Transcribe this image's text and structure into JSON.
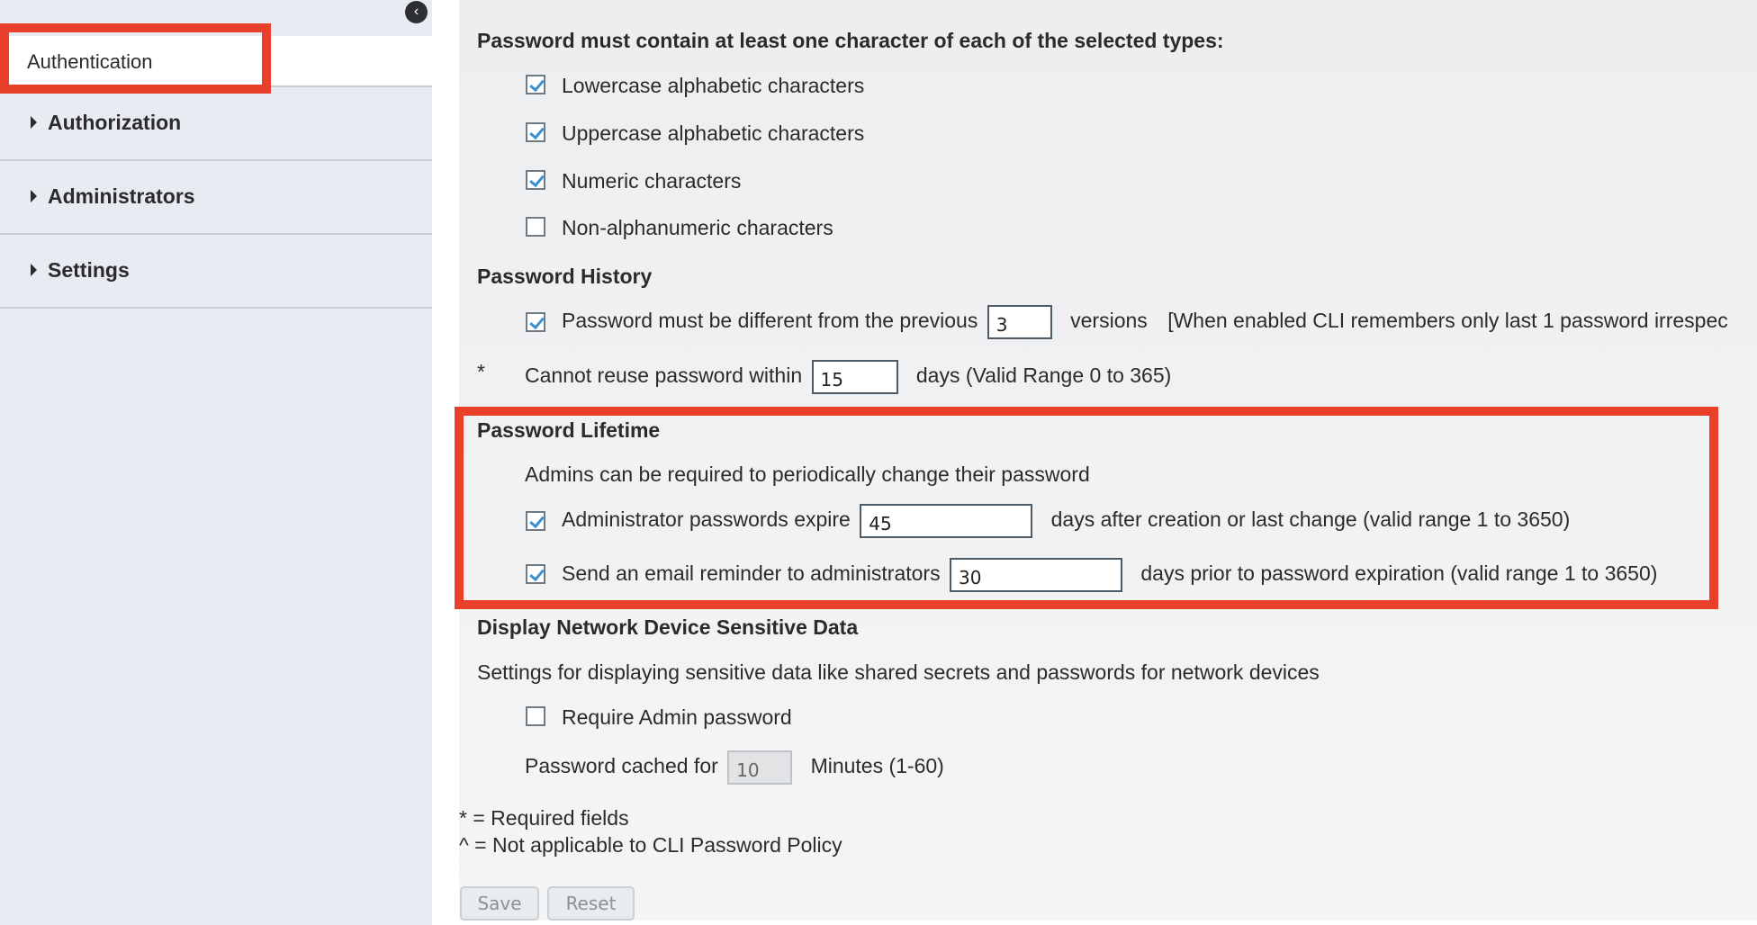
{
  "sidebar": {
    "collapse_icon": "chevron-left-icon",
    "active_item": "Authentication",
    "items": [
      {
        "label": "Authorization",
        "icon": "triangle-right-icon"
      },
      {
        "label": "Administrators",
        "icon": "triangle-right-icon"
      },
      {
        "label": "Settings",
        "icon": "triangle-right-icon"
      }
    ]
  },
  "char_types": {
    "heading": "Password must contain at least one character of each of the selected types:",
    "options": [
      {
        "label": "Lowercase alphabetic characters",
        "checked": true
      },
      {
        "label": "Uppercase alphabetic characters",
        "checked": true
      },
      {
        "label": "Numeric characters",
        "checked": true
      },
      {
        "label": "Non-alphanumeric characters",
        "checked": false
      }
    ]
  },
  "history": {
    "heading": "Password History",
    "different_label": "Password must be different from the previous",
    "different_checked": true,
    "different_value": "3",
    "different_suffix": "versions",
    "different_note": "[When enabled CLI remembers only last 1 password irrespec",
    "reuse_marker": "*",
    "reuse_label": "Cannot reuse password within",
    "reuse_value": "15",
    "reuse_suffix": "days (Valid Range 0 to 365)"
  },
  "lifetime": {
    "heading": "Password Lifetime",
    "description": "Admins can be required to periodically change their password",
    "expire_label": "Administrator passwords expire",
    "expire_checked": true,
    "expire_value": "45",
    "expire_suffix": "days after creation or last change (valid range 1 to 3650)",
    "reminder_label": "Send an email reminder to administrators",
    "reminder_checked": true,
    "reminder_value": "30",
    "reminder_suffix": "days prior to password expiration (valid range 1 to 3650)"
  },
  "sensitive": {
    "heading": "Display Network Device Sensitive Data",
    "description": "Settings for displaying sensitive data like shared secrets and passwords for network devices",
    "require_label": "Require Admin password",
    "require_checked": false,
    "cached_label": "Password cached for",
    "cached_value": "10",
    "cached_suffix": "Minutes (1-60)"
  },
  "footnotes": {
    "required": "* = Required fields",
    "not_applicable": "^ = Not applicable to CLI Password Policy"
  },
  "actions": {
    "save_label": "Save",
    "reset_label": "Reset"
  },
  "colors": {
    "highlight": "#e8402a",
    "check": "#3a8fd0",
    "sidebar_bg": "#e8ebf2"
  }
}
